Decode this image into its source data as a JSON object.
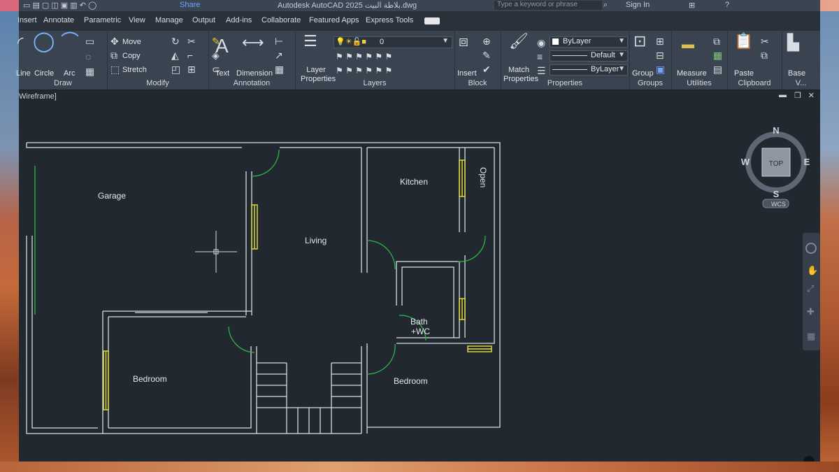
{
  "title_bar": {
    "left_text": "Share",
    "title": "Autodesk AutoCAD 2025    بلاطة البيت.dwg",
    "search_placeholder": "Type a keyword or phrase",
    "sign_in": "Sign In"
  },
  "tabs": [
    "Insert",
    "Annotate",
    "Parametric",
    "View",
    "Manage",
    "Output",
    "Add-ins",
    "Collaborate",
    "Featured Apps",
    "Express Tools"
  ],
  "ribbon": {
    "draw": {
      "title": "Draw",
      "tools": [
        "Line",
        "Circle",
        "Arc"
      ]
    },
    "modify": {
      "title": "Modify",
      "tools": [
        "Move",
        "Copy",
        "Stretch"
      ]
    },
    "annotation": {
      "title": "Annotation",
      "tools": [
        "Text",
        "Dimension"
      ]
    },
    "layers": {
      "title": "Layers",
      "tools": [
        "Layer Properties"
      ],
      "current_layer": "0"
    },
    "block": {
      "title": "Block",
      "tools": [
        "Insert"
      ]
    },
    "properties": {
      "title": "Properties",
      "tools": [
        "Match Properties"
      ],
      "color": "ByLayer",
      "lineweight": "Default",
      "linetype": "ByLayer"
    },
    "groups": {
      "title": "Groups",
      "tools": [
        "Group"
      ]
    },
    "utilities": {
      "title": "Utilities",
      "tools": [
        "Measure"
      ]
    },
    "clipboard": {
      "title": "Clipboard",
      "tools": [
        "Paste"
      ]
    },
    "view": {
      "title": "V...",
      "tools": [
        "Base"
      ]
    }
  },
  "viewport": {
    "label": "Wireframe]"
  },
  "navcube": {
    "n": "N",
    "s": "S",
    "e": "E",
    "w": "W",
    "face": "TOP",
    "ucs": "WCS"
  },
  "rooms": {
    "garage": "Garage",
    "living": "Living",
    "kitchen": "Kitchen",
    "open": "Open",
    "bath_line1": "Bath",
    "bath_line2": "+WC",
    "bedroom_left": "Bedroom",
    "bedroom_right": "Bedroom"
  },
  "colors": {
    "wall": "#d8dde3",
    "window": "#e9e03c",
    "door": "#2fb24a",
    "background": "#212830"
  }
}
